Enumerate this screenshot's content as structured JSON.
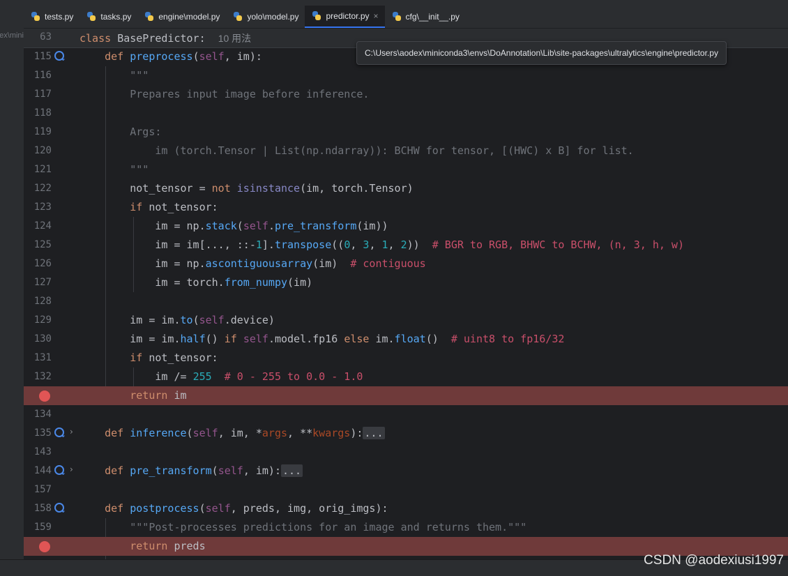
{
  "left_panel": {
    "path_fragment": "ex\\mini"
  },
  "tabs": [
    {
      "label": "tests.py",
      "active": false
    },
    {
      "label": "tasks.py",
      "active": false
    },
    {
      "label": "engine\\model.py",
      "active": false
    },
    {
      "label": "yolo\\model.py",
      "active": false
    },
    {
      "label": "predictor.py",
      "active": true
    },
    {
      "label": "cfg\\__init__.py",
      "active": false
    }
  ],
  "tab_close_glyph": "×",
  "sticky": {
    "line_number": "63",
    "keyword": "class",
    "name": "BasePredictor:",
    "usages": "10 用法"
  },
  "tooltip": {
    "path": "C:\\Users\\aodex\\miniconda3\\envs\\DoAnnotation\\Lib\\site-packages\\ultralytics\\engine\\predictor.py"
  },
  "lines": [
    {
      "ln": "115",
      "text": "    def preprocess(self, im):"
    },
    {
      "ln": "116",
      "text": "        \"\"\""
    },
    {
      "ln": "117",
      "text": "        Prepares input image before inference."
    },
    {
      "ln": "118",
      "text": ""
    },
    {
      "ln": "119",
      "text": "        Args:"
    },
    {
      "ln": "120",
      "text": "            im (torch.Tensor | List(np.ndarray)): BCHW for tensor, [(HWC) x B] for list."
    },
    {
      "ln": "121",
      "text": "        \"\"\""
    },
    {
      "ln": "122",
      "text": "        not_tensor = not isinstance(im, torch.Tensor)"
    },
    {
      "ln": "123",
      "text": "        if not_tensor:"
    },
    {
      "ln": "124",
      "text": "            im = np.stack(self.pre_transform(im))"
    },
    {
      "ln": "125",
      "text": "            im = im[..., ::-1].transpose((0, 3, 1, 2))  # BGR to RGB, BHWC to BCHW, (n, 3, h, w)"
    },
    {
      "ln": "126",
      "text": "            im = np.ascontiguousarray(im)  # contiguous"
    },
    {
      "ln": "127",
      "text": "            im = torch.from_numpy(im)"
    },
    {
      "ln": "128",
      "text": ""
    },
    {
      "ln": "129",
      "text": "        im = im.to(self.device)"
    },
    {
      "ln": "130",
      "text": "        im = im.half() if self.model.fp16 else im.float()  # uint8 to fp16/32"
    },
    {
      "ln": "131",
      "text": "        if not_tensor:"
    },
    {
      "ln": "132",
      "text": "            im /= 255  # 0 - 255 to 0.0 - 1.0"
    },
    {
      "ln": "",
      "text": "        return im",
      "breakpoint": true
    },
    {
      "ln": "134",
      "text": ""
    },
    {
      "ln": "135",
      "text": "    def inference(self, im, *args, **kwargs):..."
    },
    {
      "ln": "143",
      "text": ""
    },
    {
      "ln": "144",
      "text": "    def pre_transform(self, im):..."
    },
    {
      "ln": "157",
      "text": ""
    },
    {
      "ln": "158",
      "text": "    def postprocess(self, preds, img, orig_imgs):"
    },
    {
      "ln": "159",
      "text": "        \"\"\"Post-processes predictions for an image and returns them.\"\"\""
    },
    {
      "ln": "",
      "text": "        return preds",
      "breakpoint": true
    }
  ],
  "watermark": "CSDN @aodexiusi1997",
  "colors": {
    "breakpoint_line": "#6f3a3a",
    "breakpoint_dot": "#e05555",
    "active_tab_underline": "#3574f0"
  }
}
